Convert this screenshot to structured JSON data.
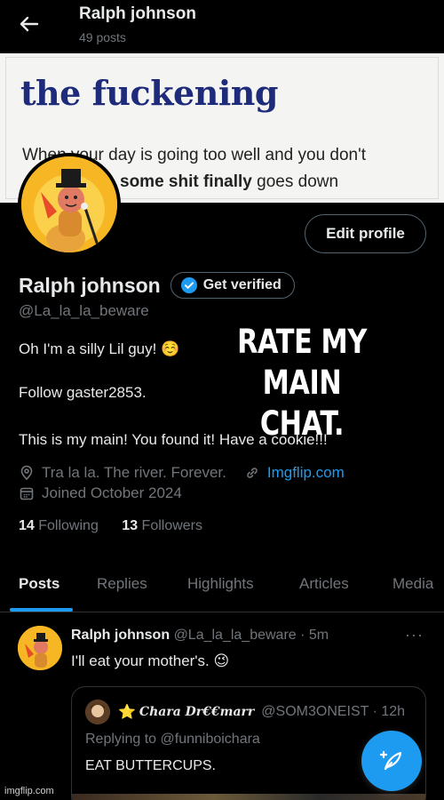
{
  "header": {
    "name": "Ralph johnson",
    "posts_count": "49 posts"
  },
  "banner": {
    "title": "the fuckening",
    "line1": "When your day is going too well and you don't",
    "line2_strong": "some shit finally",
    "line2_tail": "goes down"
  },
  "profile": {
    "edit_label": "Edit profile",
    "name": "Ralph johnson",
    "verify_label": "Get verified",
    "handle": "@La_la_la_beware",
    "bio_line1": "Oh I'm a silly Lil guy! ☺️",
    "bio_line2": "Follow  gaster2853.",
    "bio_line3": "This is my main! You found it! Have a cookie!!!",
    "location": "Tra la la. The river. Forever.",
    "website": "Imgflip.com",
    "joined": "Joined October 2024",
    "following_count": "14",
    "following_label": "Following",
    "followers_count": "13",
    "followers_label": "Followers"
  },
  "overlay": {
    "line1": "RATE MY",
    "line2": "MAIN CHAT."
  },
  "tabs": [
    {
      "label": "Posts",
      "active": true
    },
    {
      "label": "Replies",
      "active": false
    },
    {
      "label": "Highlights",
      "active": false
    },
    {
      "label": "Articles",
      "active": false
    },
    {
      "label": "Media",
      "active": false
    }
  ],
  "post": {
    "author": "Ralph johnson",
    "handle_time": "@La_la_la_beware · 5m",
    "more": "···",
    "text": "I'll eat your mother's. 😉",
    "quote": {
      "star": "⭐",
      "author": "Chara Dr€€marr",
      "handle_time": "@SOM3ONEIST · 12h",
      "reply_prefix": "Replying to",
      "reply_to": "@funniboichara",
      "text": "EAT BUTTERCUPS."
    }
  },
  "watermark": "imgflip.com",
  "colors": {
    "accent": "#1d9bf0",
    "muted": "#71767b",
    "text": "#e7e9ea",
    "banner_title": "#1e2a7a"
  },
  "icons": [
    "back-arrow-icon",
    "verified-badge-icon",
    "location-pin-icon",
    "link-icon",
    "calendar-icon",
    "compose-icon"
  ]
}
